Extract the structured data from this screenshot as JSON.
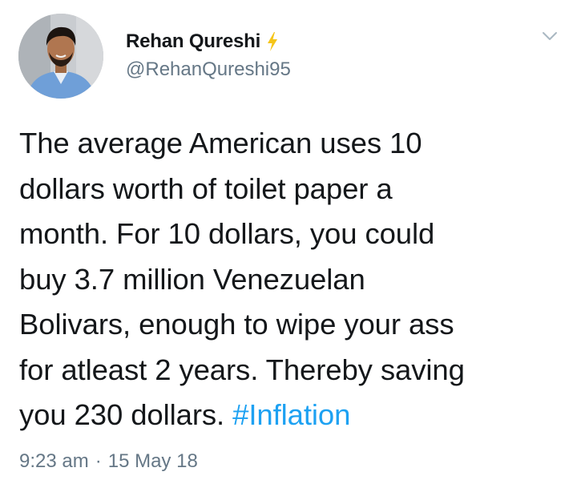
{
  "user": {
    "display_name": "Rehan Qureshi",
    "handle": "@RehanQureshi95",
    "badge_icon": "lightning-bolt-icon",
    "avatar_icon": "profile-photo"
  },
  "tweet": {
    "text": "The average American uses 10\ndollars worth of toilet paper a\nmonth. For 10 dollars, you could\nbuy 3.7 million Venezuelan\nBolivars, enough to wipe your ass\nfor atleast 2 years. Thereby saving\nyou 230 dollars. ",
    "hashtag": "#Inflation"
  },
  "meta": {
    "time": "9:23 am",
    "separator": "·",
    "date": "15 May 18"
  },
  "menu": {
    "caret_icon": "chevron-down-icon"
  },
  "colors": {
    "text": "#14171a",
    "secondary": "#657786",
    "link": "#1da1f2",
    "badge": "#f5c518"
  }
}
